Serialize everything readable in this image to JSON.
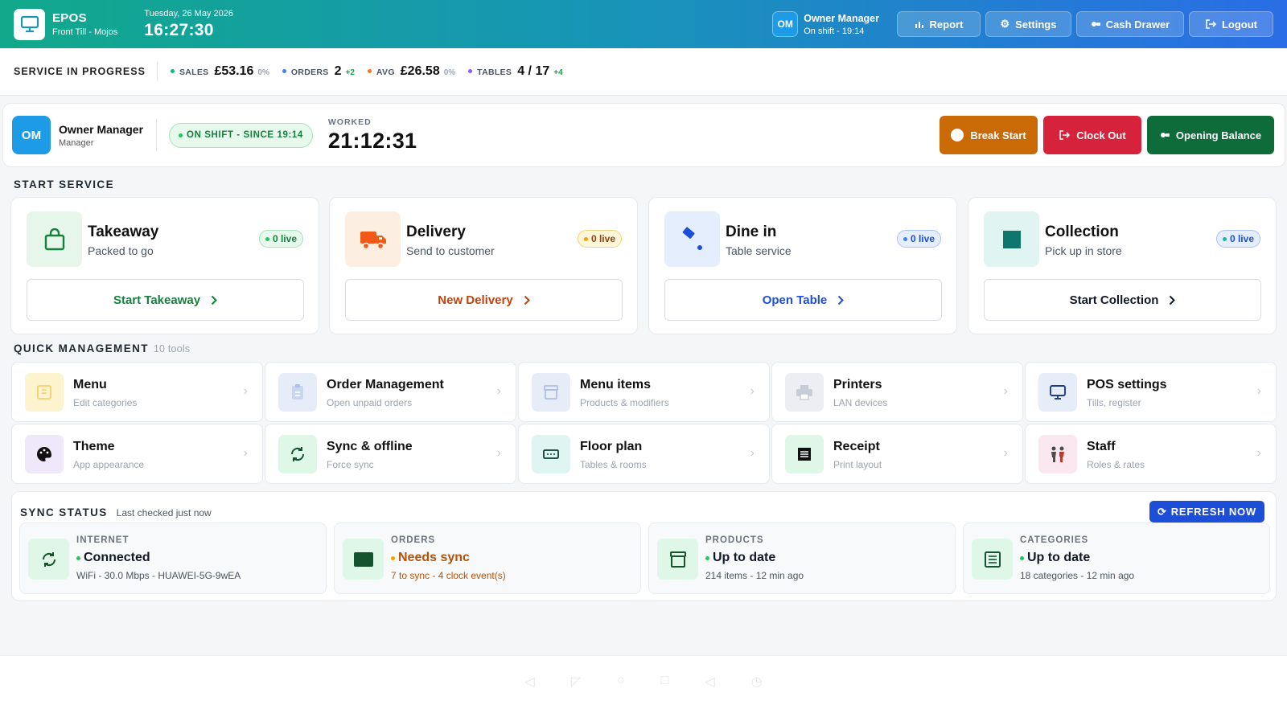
{
  "topbar": {
    "brand": "EPOS",
    "location": "Front Till - Mojos",
    "date": "Tuesday, 26 May 2026",
    "time": "16:27:30",
    "user_initials": "OM",
    "user_name": "Owner Manager",
    "user_shift": "On shift - 19:14",
    "buttons": [
      {
        "label": "Report",
        "icon": "bar-chart-icon"
      },
      {
        "label": "Settings",
        "icon": "gear-icon"
      },
      {
        "label": "Cash Drawer",
        "icon": "cash-icon"
      },
      {
        "label": "Logout",
        "icon": "logout-icon"
      }
    ]
  },
  "stats": {
    "title": "SERVICE IN PROGRESS",
    "items": [
      {
        "label": "SALES",
        "value": "£53.16",
        "delta": "0%",
        "dot": "#10b981"
      },
      {
        "label": "ORDERS",
        "value": "2",
        "delta": "+2",
        "dot": "#3b82f6"
      },
      {
        "label": "AVG",
        "value": "£26.58",
        "delta": "0%",
        "dot": "#f97316"
      },
      {
        "label": "TABLES",
        "value": "4 / 17",
        "delta": "+4",
        "dot": "#8b5cf6"
      }
    ]
  },
  "shift": {
    "initials": "OM",
    "name": "Owner Manager",
    "role": "Manager",
    "status": "ON SHIFT - SINCE 19:14",
    "worked_label": "WORKED",
    "worked_time": "21:12:31",
    "break_label": "Break Start",
    "clockout_label": "Clock Out",
    "opening_label": "Opening Balance"
  },
  "start_service": {
    "title": "START SERVICE",
    "cards": [
      {
        "title": "Takeaway",
        "sub": "Packed to go",
        "live": "0 live",
        "action": "Start Takeaway",
        "icon": "bag-icon",
        "accent": "#15803d"
      },
      {
        "title": "Delivery",
        "sub": "Send to customer",
        "live": "0 live",
        "action": "New Delivery",
        "icon": "truck-icon",
        "accent": "#c2410c"
      },
      {
        "title": "Dine in",
        "sub": "Table service",
        "live": "0 live",
        "action": "Open Table",
        "icon": "table-icon",
        "accent": "#1d4ed8"
      },
      {
        "title": "Collection",
        "sub": "Pick up in store",
        "live": "0 live",
        "action": "Start Collection",
        "icon": "store-icon",
        "accent": "#111827"
      }
    ]
  },
  "quick_management": {
    "title": "QUICK MANAGEMENT",
    "count": "10 tools",
    "tools": [
      {
        "title": "Menu",
        "sub": "Edit categories",
        "icon": "menu-book-icon"
      },
      {
        "title": "Order Management",
        "sub": "Open unpaid orders",
        "icon": "clipboard-icon"
      },
      {
        "title": "Menu items",
        "sub": "Products & modifiers",
        "icon": "box-icon"
      },
      {
        "title": "Printers",
        "sub": "LAN devices",
        "icon": "printer-icon"
      },
      {
        "title": "POS settings",
        "sub": "Tills, register",
        "icon": "monitor-icon"
      },
      {
        "title": "Theme",
        "sub": "App appearance",
        "icon": "palette-icon"
      },
      {
        "title": "Sync & offline",
        "sub": "Force sync",
        "icon": "sync-icon"
      },
      {
        "title": "Floor plan",
        "sub": "Tables & rooms",
        "icon": "floor-plan-icon"
      },
      {
        "title": "Receipt",
        "sub": "Print layout",
        "icon": "receipt-icon"
      },
      {
        "title": "Staff",
        "sub": "Roles & rates",
        "icon": "staff-icon"
      }
    ]
  },
  "sync": {
    "title": "SYNC STATUS",
    "checked": "Last checked just now",
    "refresh_label": "REFRESH NOW",
    "items": [
      {
        "label": "INTERNET",
        "status": "Connected",
        "detail": "WiFi - 30.0 Mbps - HUAWEI-5G-9wEA",
        "color": "#111827",
        "dot": "#22c55e",
        "icon": "sync-icon"
      },
      {
        "label": "ORDERS",
        "status": "Needs sync",
        "detail": "7 to sync  -  4 clock event(s)",
        "color": "#b45309",
        "dot": "#f59e0b",
        "icon": "orders-icon"
      },
      {
        "label": "PRODUCTS",
        "status": "Up to date",
        "detail": "214 items - 12 min ago",
        "color": "#111827",
        "dot": "#22c55e",
        "icon": "box-icon"
      },
      {
        "label": "CATEGORIES",
        "status": "Up to date",
        "detail": "18 categories - 12 min ago",
        "color": "#111827",
        "dot": "#22c55e",
        "icon": "list-icon"
      }
    ]
  }
}
